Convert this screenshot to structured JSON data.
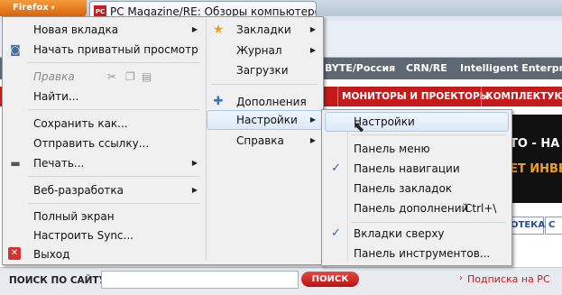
{
  "browser": {
    "menu_button": "Firefox",
    "menu_button_arrow": "▾",
    "tab_title": "PC Magazine/RE: Обзоры компьютеро...",
    "tab_favicon": "PC"
  },
  "page": {
    "top_nav": [
      "BYTE/Россия",
      "CRN/RE",
      "Intelligent Enterprise"
    ],
    "red_nav": [
      "МОНИТОРЫ И ПРОЕКТОРЫ",
      "КОМПЛЕКТУЮЩ"
    ],
    "banner_lines": [
      "ТО - НА",
      "ЕТ ИНВЕС"
    ],
    "tabs": [
      "ОТЕКА",
      "С"
    ],
    "search_label": "ПОИСК ПО САЙТУ",
    "search_value": "",
    "search_button": "ПОИСК",
    "subscribe_arrow": "›",
    "subscribe_link": "Подписка на PC"
  },
  "main_menu": {
    "items": [
      {
        "label": "Новая вкладка",
        "has_submenu": true
      },
      {
        "label": "Начать приватный просмотр",
        "icon": "mask-icon"
      },
      {
        "label": "Правка",
        "disabled": true
      },
      {
        "label": "Найти..."
      },
      {
        "label": "Сохранить как..."
      },
      {
        "label": "Отправить ссылку..."
      },
      {
        "label": "Печать...",
        "has_submenu": true,
        "icon": "printer-icon"
      },
      {
        "label": "Веб-разработка",
        "has_submenu": true
      },
      {
        "label": "Полный экран"
      },
      {
        "label": "Настроить Sync..."
      },
      {
        "label": "Выход",
        "icon": "exit-icon"
      }
    ],
    "right_items": [
      {
        "label": "Закладки",
        "has_submenu": true,
        "icon": "star-icon"
      },
      {
        "label": "Журнал",
        "has_submenu": true
      },
      {
        "label": "Загрузки"
      },
      {
        "label": "Дополнения",
        "icon": "puzzle-icon"
      },
      {
        "label": "Настройки",
        "has_submenu": true,
        "highlighted": true
      },
      {
        "label": "Справка",
        "has_submenu": true
      }
    ]
  },
  "settings_submenu": {
    "items": [
      {
        "label": "Настройки",
        "highlighted": true
      },
      {
        "label": "Панель меню"
      },
      {
        "label": "Панель навигации",
        "checked": true
      },
      {
        "label": "Панель закладок"
      },
      {
        "label": "Панель дополнений",
        "shortcut": "Ctrl+\\"
      },
      {
        "label": "Вкладки сверху",
        "checked": true
      },
      {
        "label": "Панель инструментов..."
      }
    ]
  },
  "colors": {
    "firefox_orange": "#e4771f",
    "site_red": "#c71a1a",
    "menu_bg": "#f0f0f0",
    "check_blue": "#2b63b8"
  }
}
